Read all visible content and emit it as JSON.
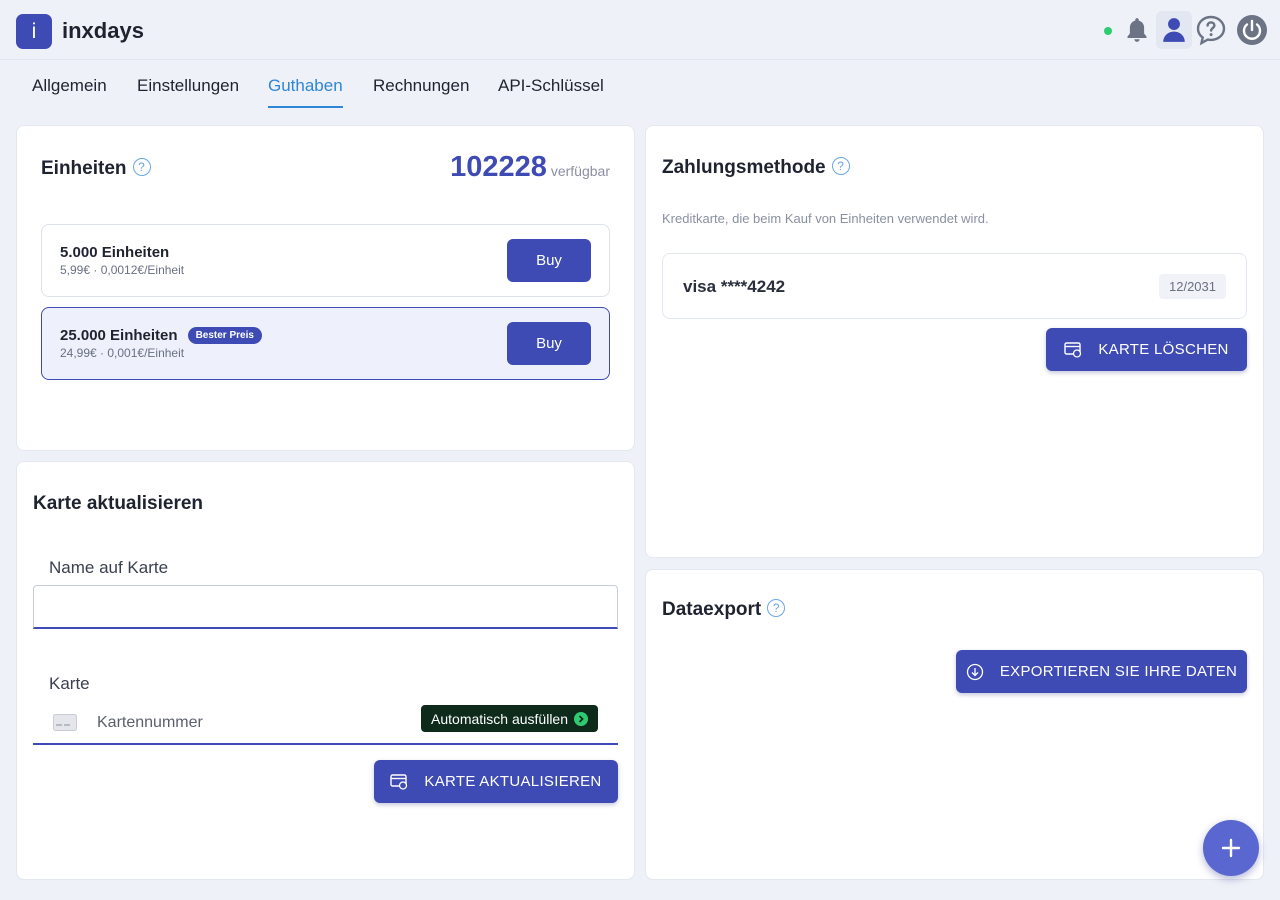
{
  "app": {
    "logo_letter": "i",
    "name": "inxdays"
  },
  "header": {
    "status_color": "#2ecc71",
    "icons": [
      "bell-icon",
      "user-icon",
      "help-bubble-icon",
      "power-icon"
    ]
  },
  "tabs": [
    {
      "label": "Allgemein",
      "active": false
    },
    {
      "label": "Einstellungen",
      "active": false
    },
    {
      "label": "Guthaben",
      "active": true
    },
    {
      "label": "Rechnungen",
      "active": false
    },
    {
      "label": "API-Schlüssel",
      "active": false
    }
  ],
  "units": {
    "title": "Einheiten",
    "help": "?",
    "available_value": "102228",
    "available_label": "verfügbar",
    "packages": [
      {
        "name": "5.000 Einheiten",
        "price": "5,99€ · 0,0012€/Einheit",
        "button": "Buy"
      },
      {
        "name": "25.000 Einheiten",
        "badge": "Bester Preis",
        "price": "24,99€ · 0,001€/Einheit",
        "button": "Buy"
      }
    ]
  },
  "update_card": {
    "title": "Karte aktualisieren",
    "name_label": "Name auf Karte",
    "name_value": "",
    "card_label": "Karte",
    "card_placeholder": "Kartennummer",
    "autofill_label": "Automatisch ausfüllen",
    "button": "KARTE AKTUALISIEREN"
  },
  "payment": {
    "title": "Zahlungsmethode",
    "help": "?",
    "description": "Kreditkarte, die beim Kauf von Einheiten verwendet wird.",
    "card_brand": "visa",
    "card_masked": "****4242",
    "expiry": "12/2031",
    "delete_button": "KARTE LÖSCHEN"
  },
  "export": {
    "title": "Dataexport",
    "help": "?",
    "button": "EXPORTIEREN SIE IHRE DATEN"
  },
  "colors": {
    "primary": "#3e4bb4",
    "accent_tab": "#2f86d6",
    "fab": "#5a67d0"
  }
}
